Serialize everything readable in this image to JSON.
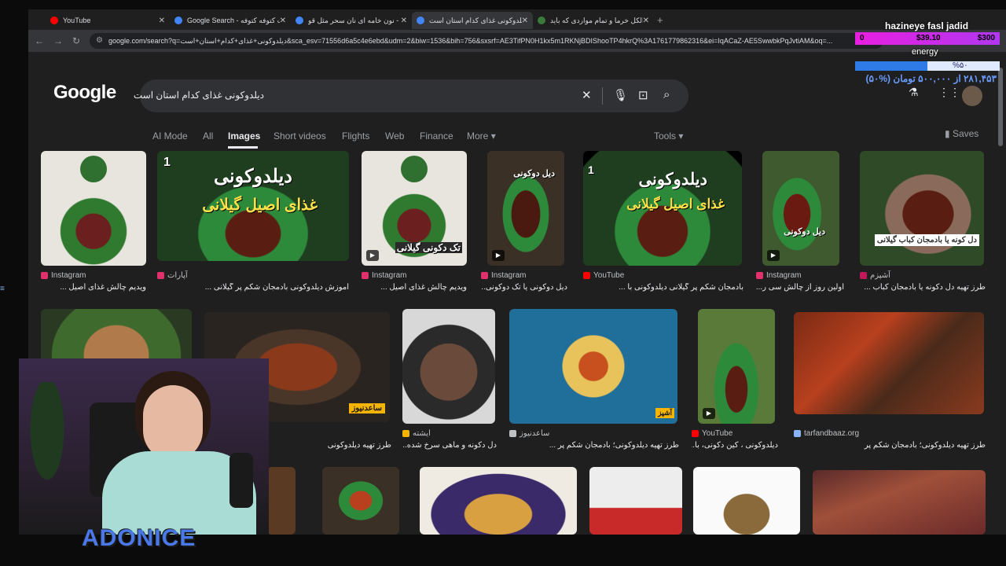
{
  "browser": {
    "tabs": [
      {
        "title": "YouTube",
        "favicon_color": "#ff0000",
        "active": false
      },
      {
        "title": "Google Search - پخت کتوفه کتوفه",
        "favicon_color": "#4285f4",
        "active": false
      },
      {
        "title": "نون خامه ای نان سحر مثل قو - ch",
        "favicon_color": "#4285f4",
        "active": false
      },
      {
        "title": "دیلدوکونی غذای کدام استان است",
        "favicon_color": "#4285f4",
        "active": true
      },
      {
        "title": "الکل خرما و تمام مواردی که باید",
        "favicon_color": "#3a7a3a",
        "active": false
      }
    ],
    "close_glyph": "✕",
    "new_tab_glyph": "+",
    "url": "google.com/search?q=دیلدوکونی+غذای+کدام+استان+است&sca_esv=71556d6a5c4e6ebd&udm=2&biw=1536&bih=756&sxsrf=AE3TifPN0H1kx5m1RKNjBDIShooTP4hkrQ%3A1761779862316&ei=IqACaZ-AE5SwwbkPqJvtiAM&oq=..."
  },
  "google": {
    "logo": "Google",
    "query": "دیلدوکونی غذای کدام استان است",
    "tabs": [
      "AI Mode",
      "All",
      "Images",
      "Short videos",
      "Flights",
      "Web",
      "Finance",
      "More"
    ],
    "active_tab": "Images",
    "tools_label": "Tools",
    "saves_label": "Saves"
  },
  "results_row1": [
    {
      "source": "Instagram",
      "caption": "ویدیم چالش غذای اصیل ...",
      "src_color": "#e1306c",
      "play": false
    },
    {
      "source": "آپارات",
      "caption": "آموزش دیلدوکونی بادمجان شکم پر گیلانی ...",
      "src_color": "#e1306c",
      "play": false,
      "banner_top": "دیلدوکونی",
      "banner_bottom": "غذای اصیل گیلانی",
      "badge": "1"
    },
    {
      "source": "Instagram",
      "caption": "ویدیم چالش غذای اصیل ...",
      "src_color": "#e1306c",
      "play": true,
      "banner_bottom": "تک دکونی گیلانی"
    },
    {
      "source": "Instagram",
      "caption": "دیل دوکونی یا تک دوکونی...",
      "src_color": "#e1306c",
      "play": true,
      "banner_top": "دیل دوکونی"
    },
    {
      "source": "YouTube",
      "caption": "بادمجان شکم پر گیلانی دیلدوکونی با ...",
      "src_color": "#ff0000",
      "play": false,
      "banner_top": "دیلدوکونی",
      "banner_bottom": "غذای اصیل گیلانی",
      "badge": "1"
    },
    {
      "source": "Instagram",
      "caption": "اولین روز از چالش سی ر...",
      "src_color": "#e1306c",
      "play": true,
      "banner_bottom": "دیل دوکونی"
    },
    {
      "source": "آشپزم",
      "caption": "طرز تهیه دل دکونه یا بادمجان کباب ...",
      "src_color": "#c2185b",
      "play": false,
      "banner_bottom": "دل کونه یا بادمجان کباب گیلانی"
    }
  ],
  "results_row2": [
    {
      "source": "",
      "caption": "",
      "src_color": "#888888"
    },
    {
      "source": "",
      "caption": "طرز تهیه دیلدوکونی",
      "src_color": "#888888",
      "badge_text": "ساعدنیوز"
    },
    {
      "source": "ایشته",
      "caption": "دل دکونه و ماهی سرخ شده...",
      "src_color": "#f4b400"
    },
    {
      "source": "ساعدنیوز",
      "caption": "طرز تهیه دیلدوکونی؛ بادمجان شکم پر ...",
      "src_color": "#bdc1c6",
      "badge_text": "آشپز"
    },
    {
      "source": "YouTube",
      "caption": "دیلدوکونی ، کین دکونی، با...",
      "src_color": "#ff0000",
      "play": true
    },
    {
      "source": "tarfandbaaz.org",
      "caption": "طرز تهیه دیلدوکونی؛ بادمجان شکم پر",
      "src_color": "#8ab4f8"
    }
  ],
  "overlay": {
    "title": "hazineye fasl jadid",
    "bar_min": "0",
    "bar_mid": "$39.10",
    "bar_max": "$300",
    "energy_label": "energy",
    "energy_percent_text": "%۵۰",
    "energy_fraction": 0.5,
    "money_text": "۲۸۱,۴۵۳ از ۵۰۰,۰۰۰ تومان (%۵۰)",
    "brand": "ADONICE",
    "bar_color": "#e81fe0",
    "energy_color": "#2e7be8"
  }
}
